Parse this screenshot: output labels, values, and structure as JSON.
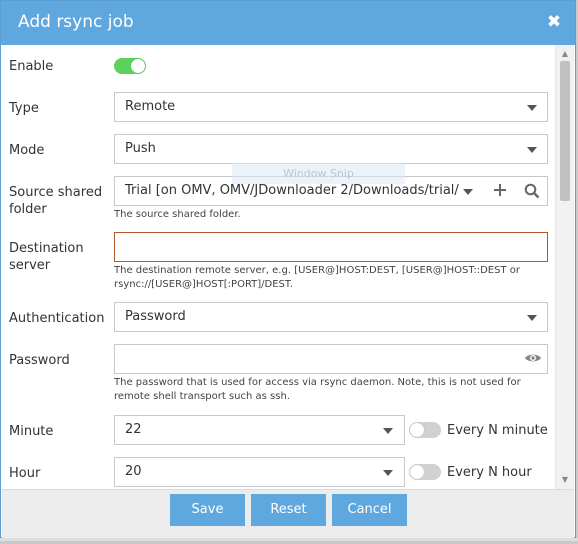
{
  "dialog": {
    "title": "Add rsync job"
  },
  "form": {
    "enable": {
      "label": "Enable",
      "on": true
    },
    "type": {
      "label": "Type",
      "value": "Remote"
    },
    "mode": {
      "label": "Mode",
      "value": "Push"
    },
    "source": {
      "label_line1": "Source shared",
      "label_line2": "folder",
      "value": "Trial [on OMV, OMV/JDownloader 2/Downloads/trial/",
      "hint": "The source shared folder."
    },
    "destination": {
      "label_line1": "Destination",
      "label_line2": "server",
      "value": "",
      "hint": "The destination remote server, e.g. [USER@]HOST:DEST, [USER@]HOST::DEST or rsync://[USER@]HOST[:PORT]/DEST."
    },
    "authentication": {
      "label": "Authentication",
      "value": "Password"
    },
    "password": {
      "label": "Password",
      "value": "",
      "hint": "The password that is used for access via rsync daemon. Note, this is not used for remote shell transport such as ssh."
    },
    "minute": {
      "label": "Minute",
      "value": "22",
      "toggle_label": "Every N minute",
      "toggle_on": false
    },
    "hour": {
      "label": "Hour",
      "value": "20",
      "toggle_label": "Every N hour",
      "toggle_on": false
    }
  },
  "overlay": {
    "watermark": "Window Snip"
  },
  "footer": {
    "save": "Save",
    "reset": "Reset",
    "cancel": "Cancel"
  },
  "icons": {
    "close": "close-icon",
    "dropdown": "chevron-down-icon",
    "add": "plus-icon",
    "search": "search-icon",
    "show_password": "eye-icon"
  },
  "colors": {
    "header": "#5ea8df",
    "button": "#5ea8df",
    "toggle_on": "#5cd15c",
    "toggle_off": "#d1d1d1",
    "error_border": "#b5562f"
  }
}
